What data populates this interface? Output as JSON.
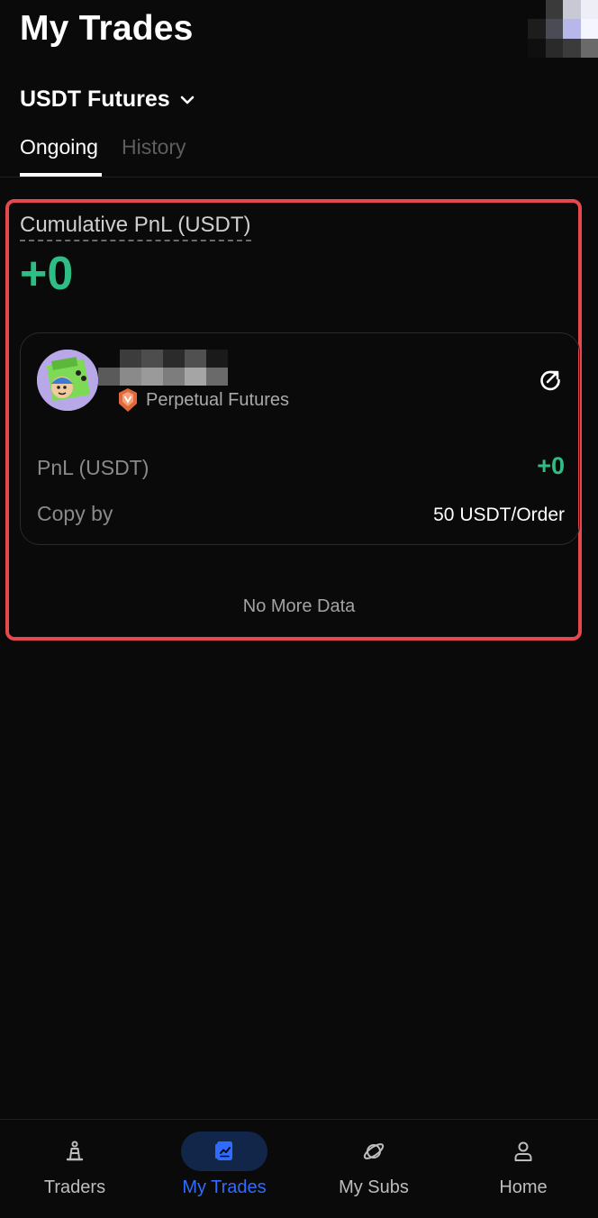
{
  "header": {
    "title": "My Trades",
    "market_selector": "USDT Futures"
  },
  "tabs": [
    {
      "label": "Ongoing",
      "active": true
    },
    {
      "label": "History",
      "active": false
    }
  ],
  "summary": {
    "cumulative_label": "Cumulative PnL (USDT)",
    "cumulative_value": "+0"
  },
  "trade_card": {
    "trader_name": "",
    "product_badge": "Perpetual Futures",
    "pnl_label": "PnL (USDT)",
    "pnl_value": "+0",
    "copy_label": "Copy by",
    "copy_value": "50 USDT/Order"
  },
  "list_footer": "No More Data",
  "bottom_nav": [
    {
      "label": "Traders",
      "icon": "traders-icon",
      "active": false
    },
    {
      "label": "My Trades",
      "icon": "my-trades-icon",
      "active": true
    },
    {
      "label": "My Subs",
      "icon": "my-subs-icon",
      "active": false
    },
    {
      "label": "Home",
      "icon": "home-person-icon",
      "active": false
    }
  ],
  "colors": {
    "background": "#0a0a0a",
    "profit_green": "#2ebd85",
    "accent_blue": "#2f6bff",
    "highlight_red": "#e5484d"
  }
}
